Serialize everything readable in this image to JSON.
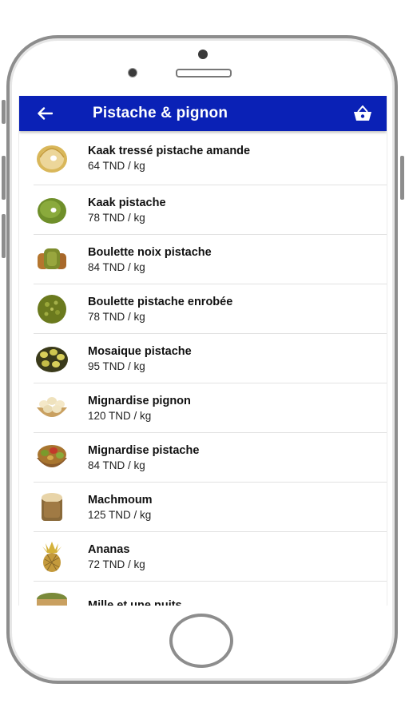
{
  "appbar": {
    "title": "Pistache & pignon",
    "back_icon": "arrow-left-icon",
    "cart_icon": "shopping-basket-icon",
    "color": "#0a21b6"
  },
  "products": [
    {
      "name": "Kaak tressé pistache amande",
      "price": "64 TND / kg",
      "image": "kaak-tresse"
    },
    {
      "name": "Kaak pistache",
      "price": "78 TND / kg",
      "image": "kaak-pistache"
    },
    {
      "name": "Boulette noix pistache",
      "price": "84 TND / kg",
      "image": "boulette-noix"
    },
    {
      "name": "Boulette pistache enrobée",
      "price": "78 TND / kg",
      "image": "boulette-enrobee"
    },
    {
      "name": "Mosaique pistache",
      "price": "95 TND / kg",
      "image": "mosaique"
    },
    {
      "name": "Mignardise pignon",
      "price": "120 TND / kg",
      "image": "mignardise-pignon"
    },
    {
      "name": "Mignardise pistache",
      "price": "84 TND / kg",
      "image": "mignardise-pistache"
    },
    {
      "name": "Machmoum",
      "price": "125 TND / kg",
      "image": "machmoum"
    },
    {
      "name": "Ananas",
      "price": "72 TND / kg",
      "image": "ananas"
    },
    {
      "name": "Mille et une nuits",
      "price": "",
      "image": "mille-nuits"
    }
  ]
}
